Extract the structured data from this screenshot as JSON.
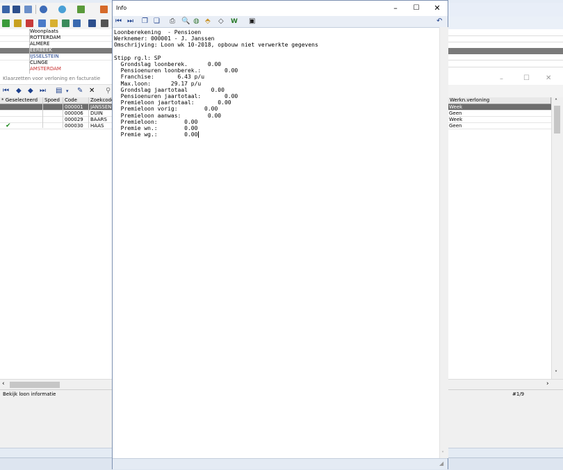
{
  "woonplaats": {
    "header": "Woonplaats",
    "rows": [
      "ROTTERDAM",
      "ALMERE",
      "EERBEEK",
      "IJSSELSTEIN",
      "CLINGE",
      "AMSTERDAM"
    ]
  },
  "klaarzetten": {
    "title": "Klaarzetten voor verloning en facturatie",
    "columns": {
      "geselecteerd": "* Geselecteerd",
      "spoed": "Spoed",
      "code": "Code",
      "zoekcode": "Zoekcode",
      "werkn_verloning": "Werkn.verloning"
    },
    "rows": [
      {
        "checked": "",
        "code": "000001",
        "zoekcode": "JANSSEN",
        "verloning": "Week"
      },
      {
        "checked": "",
        "code": "000006",
        "zoekcode": "DUIN",
        "verloning": "Geen"
      },
      {
        "checked": "",
        "code": "000029",
        "zoekcode": "BAARS",
        "verloning": "Week"
      },
      {
        "checked": "✔",
        "code": "000030",
        "zoekcode": "HAAS",
        "verloning": "Geen"
      }
    ],
    "status_left": "Bekijk loon informatie",
    "status_right": "#1/9",
    "check_color": "#1e8a1e"
  },
  "info": {
    "title": "Info",
    "lines": [
      "Loonberekening  - Pensioen",
      "Werknemer: 000001 - J. Janssen",
      "Omschrijving: Loon wk 10-2018, opbouw niet verwerkte gegevens",
      "",
      "Stipp rg.l: SP",
      "  Grondslag loonberek.      0.00",
      "  Pensioenuren loonberek.:       0.00",
      "  Franchise:       6.43 p/u",
      "  Max.loon:      29.17 p/u",
      "  Grondslag jaartotaal       0.00",
      "  Pensioenuren jaartotaal:       0.00",
      "  Premieloon jaartotaal:       0.00",
      "  Premieloon vorig:        0.00",
      "  Premieloon aanwas:        0.00",
      "  Premieloon:        0.00",
      "  Premie wn.:        0.00",
      "  Premie wg.:        0.00"
    ]
  },
  "colors": {
    "selected_row": "#6d6d6d",
    "highlight_row": "#7a7a7a",
    "link_text": "#1c3f8c",
    "window_border": "#7a8fb0"
  }
}
